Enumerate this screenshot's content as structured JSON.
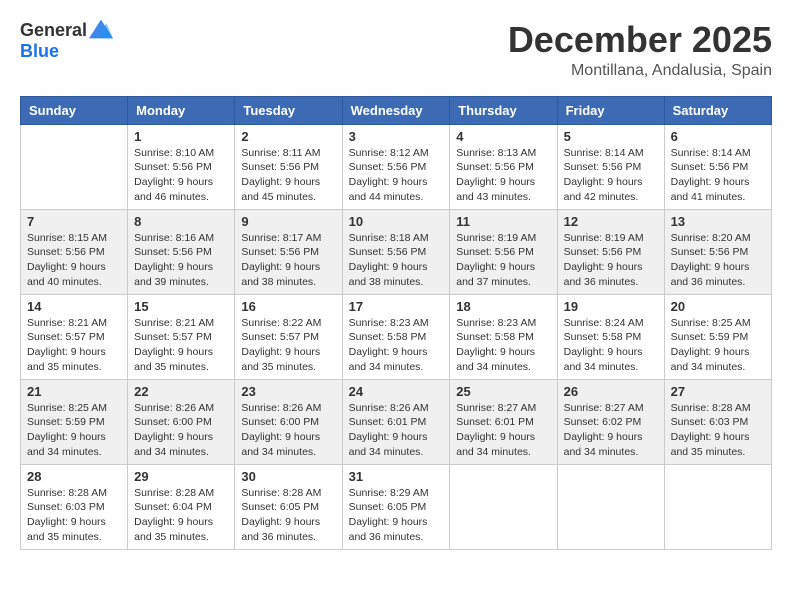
{
  "header": {
    "logo_general": "General",
    "logo_blue": "Blue",
    "month": "December 2025",
    "location": "Montillana, Andalusia, Spain"
  },
  "weekdays": [
    "Sunday",
    "Monday",
    "Tuesday",
    "Wednesday",
    "Thursday",
    "Friday",
    "Saturday"
  ],
  "weeks": [
    [
      {
        "day": "",
        "sunrise": "",
        "sunset": "",
        "daylight": ""
      },
      {
        "day": "1",
        "sunrise": "Sunrise: 8:10 AM",
        "sunset": "Sunset: 5:56 PM",
        "daylight": "Daylight: 9 hours and 46 minutes."
      },
      {
        "day": "2",
        "sunrise": "Sunrise: 8:11 AM",
        "sunset": "Sunset: 5:56 PM",
        "daylight": "Daylight: 9 hours and 45 minutes."
      },
      {
        "day": "3",
        "sunrise": "Sunrise: 8:12 AM",
        "sunset": "Sunset: 5:56 PM",
        "daylight": "Daylight: 9 hours and 44 minutes."
      },
      {
        "day": "4",
        "sunrise": "Sunrise: 8:13 AM",
        "sunset": "Sunset: 5:56 PM",
        "daylight": "Daylight: 9 hours and 43 minutes."
      },
      {
        "day": "5",
        "sunrise": "Sunrise: 8:14 AM",
        "sunset": "Sunset: 5:56 PM",
        "daylight": "Daylight: 9 hours and 42 minutes."
      },
      {
        "day": "6",
        "sunrise": "Sunrise: 8:14 AM",
        "sunset": "Sunset: 5:56 PM",
        "daylight": "Daylight: 9 hours and 41 minutes."
      }
    ],
    [
      {
        "day": "7",
        "sunrise": "Sunrise: 8:15 AM",
        "sunset": "Sunset: 5:56 PM",
        "daylight": "Daylight: 9 hours and 40 minutes."
      },
      {
        "day": "8",
        "sunrise": "Sunrise: 8:16 AM",
        "sunset": "Sunset: 5:56 PM",
        "daylight": "Daylight: 9 hours and 39 minutes."
      },
      {
        "day": "9",
        "sunrise": "Sunrise: 8:17 AM",
        "sunset": "Sunset: 5:56 PM",
        "daylight": "Daylight: 9 hours and 38 minutes."
      },
      {
        "day": "10",
        "sunrise": "Sunrise: 8:18 AM",
        "sunset": "Sunset: 5:56 PM",
        "daylight": "Daylight: 9 hours and 38 minutes."
      },
      {
        "day": "11",
        "sunrise": "Sunrise: 8:19 AM",
        "sunset": "Sunset: 5:56 PM",
        "daylight": "Daylight: 9 hours and 37 minutes."
      },
      {
        "day": "12",
        "sunrise": "Sunrise: 8:19 AM",
        "sunset": "Sunset: 5:56 PM",
        "daylight": "Daylight: 9 hours and 36 minutes."
      },
      {
        "day": "13",
        "sunrise": "Sunrise: 8:20 AM",
        "sunset": "Sunset: 5:56 PM",
        "daylight": "Daylight: 9 hours and 36 minutes."
      }
    ],
    [
      {
        "day": "14",
        "sunrise": "Sunrise: 8:21 AM",
        "sunset": "Sunset: 5:57 PM",
        "daylight": "Daylight: 9 hours and 35 minutes."
      },
      {
        "day": "15",
        "sunrise": "Sunrise: 8:21 AM",
        "sunset": "Sunset: 5:57 PM",
        "daylight": "Daylight: 9 hours and 35 minutes."
      },
      {
        "day": "16",
        "sunrise": "Sunrise: 8:22 AM",
        "sunset": "Sunset: 5:57 PM",
        "daylight": "Daylight: 9 hours and 35 minutes."
      },
      {
        "day": "17",
        "sunrise": "Sunrise: 8:23 AM",
        "sunset": "Sunset: 5:58 PM",
        "daylight": "Daylight: 9 hours and 34 minutes."
      },
      {
        "day": "18",
        "sunrise": "Sunrise: 8:23 AM",
        "sunset": "Sunset: 5:58 PM",
        "daylight": "Daylight: 9 hours and 34 minutes."
      },
      {
        "day": "19",
        "sunrise": "Sunrise: 8:24 AM",
        "sunset": "Sunset: 5:58 PM",
        "daylight": "Daylight: 9 hours and 34 minutes."
      },
      {
        "day": "20",
        "sunrise": "Sunrise: 8:25 AM",
        "sunset": "Sunset: 5:59 PM",
        "daylight": "Daylight: 9 hours and 34 minutes."
      }
    ],
    [
      {
        "day": "21",
        "sunrise": "Sunrise: 8:25 AM",
        "sunset": "Sunset: 5:59 PM",
        "daylight": "Daylight: 9 hours and 34 minutes."
      },
      {
        "day": "22",
        "sunrise": "Sunrise: 8:26 AM",
        "sunset": "Sunset: 6:00 PM",
        "daylight": "Daylight: 9 hours and 34 minutes."
      },
      {
        "day": "23",
        "sunrise": "Sunrise: 8:26 AM",
        "sunset": "Sunset: 6:00 PM",
        "daylight": "Daylight: 9 hours and 34 minutes."
      },
      {
        "day": "24",
        "sunrise": "Sunrise: 8:26 AM",
        "sunset": "Sunset: 6:01 PM",
        "daylight": "Daylight: 9 hours and 34 minutes."
      },
      {
        "day": "25",
        "sunrise": "Sunrise: 8:27 AM",
        "sunset": "Sunset: 6:01 PM",
        "daylight": "Daylight: 9 hours and 34 minutes."
      },
      {
        "day": "26",
        "sunrise": "Sunrise: 8:27 AM",
        "sunset": "Sunset: 6:02 PM",
        "daylight": "Daylight: 9 hours and 34 minutes."
      },
      {
        "day": "27",
        "sunrise": "Sunrise: 8:28 AM",
        "sunset": "Sunset: 6:03 PM",
        "daylight": "Daylight: 9 hours and 35 minutes."
      }
    ],
    [
      {
        "day": "28",
        "sunrise": "Sunrise: 8:28 AM",
        "sunset": "Sunset: 6:03 PM",
        "daylight": "Daylight: 9 hours and 35 minutes."
      },
      {
        "day": "29",
        "sunrise": "Sunrise: 8:28 AM",
        "sunset": "Sunset: 6:04 PM",
        "daylight": "Daylight: 9 hours and 35 minutes."
      },
      {
        "day": "30",
        "sunrise": "Sunrise: 8:28 AM",
        "sunset": "Sunset: 6:05 PM",
        "daylight": "Daylight: 9 hours and 36 minutes."
      },
      {
        "day": "31",
        "sunrise": "Sunrise: 8:29 AM",
        "sunset": "Sunset: 6:05 PM",
        "daylight": "Daylight: 9 hours and 36 minutes."
      },
      {
        "day": "",
        "sunrise": "",
        "sunset": "",
        "daylight": ""
      },
      {
        "day": "",
        "sunrise": "",
        "sunset": "",
        "daylight": ""
      },
      {
        "day": "",
        "sunrise": "",
        "sunset": "",
        "daylight": ""
      }
    ]
  ]
}
